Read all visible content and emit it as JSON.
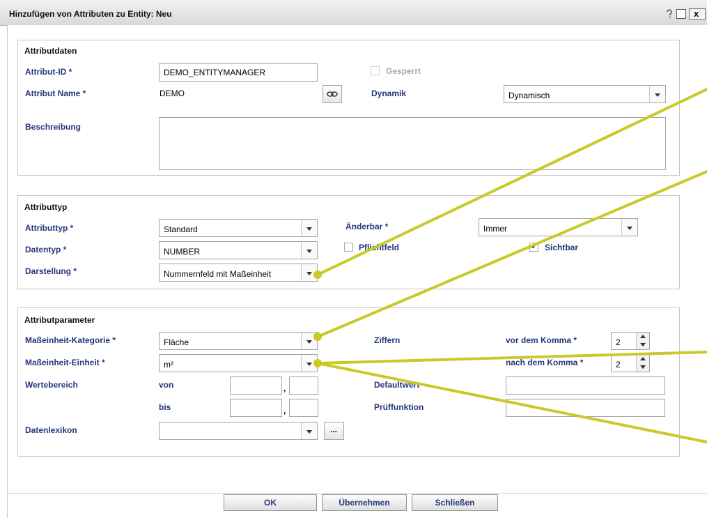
{
  "window": {
    "title": "Hinzufügen von Attributen zu Entity: Neu",
    "close_glyph": "x"
  },
  "attributdaten": {
    "title": "Attributdaten",
    "id_label": "Attribut-ID *",
    "id_value": "DEMO_ENTITYMANAGER",
    "gesperrt_label": "Gesperrt",
    "gesperrt_checked": false,
    "name_label": "Attribut Name *",
    "name_value": "DEMO",
    "dynamik_label": "Dynamik",
    "dynamik_value": "Dynamisch",
    "beschreibung_label": "Beschreibung",
    "beschreibung_value": ""
  },
  "attributtyp": {
    "title": "Attributtyp",
    "typ_label": "Attributtyp *",
    "typ_value": "Standard",
    "aenderbar_label": "Änderbar *",
    "aenderbar_value": "Immer",
    "datentyp_label": "Datentyp *",
    "datentyp_value": "NUMBER",
    "pflichtfeld_label": "Pflichtfeld",
    "pflichtfeld_checked": false,
    "sichtbar_label": "Sichtbar",
    "sichtbar_checked": true,
    "darstellung_label": "Darstellung *",
    "darstellung_value": "Nummernfeld mit Maßeinheit"
  },
  "attributparameter": {
    "title": "Attributparameter",
    "kategorie_label": "Maßeinheit-Kategorie *",
    "kategorie_value": "Fläche",
    "einheit_label": "Maßeinheit-Einheit *",
    "einheit_value": "m²",
    "ziffern_label": "Ziffern",
    "vor_komma_label": "vor dem Komma *",
    "vor_komma_value": "2",
    "nach_komma_label": "nach dem Komma *",
    "nach_komma_value": "2",
    "wertebereich_label": "Wertebereich",
    "von_label": "von",
    "bis_label": "bis",
    "comma": ",",
    "defaultwert_label": "Defaultwert",
    "pruef_label": "Prüffunktion",
    "datenlexikon_label": "Datenlexikon",
    "datenlexikon_value": "",
    "ellipsis": "..."
  },
  "buttons": {
    "ok": "OK",
    "apply": "Übernehmen",
    "close": "Schließen"
  },
  "colors": {
    "label": "#27357a",
    "annotation": "#c9c92a"
  }
}
